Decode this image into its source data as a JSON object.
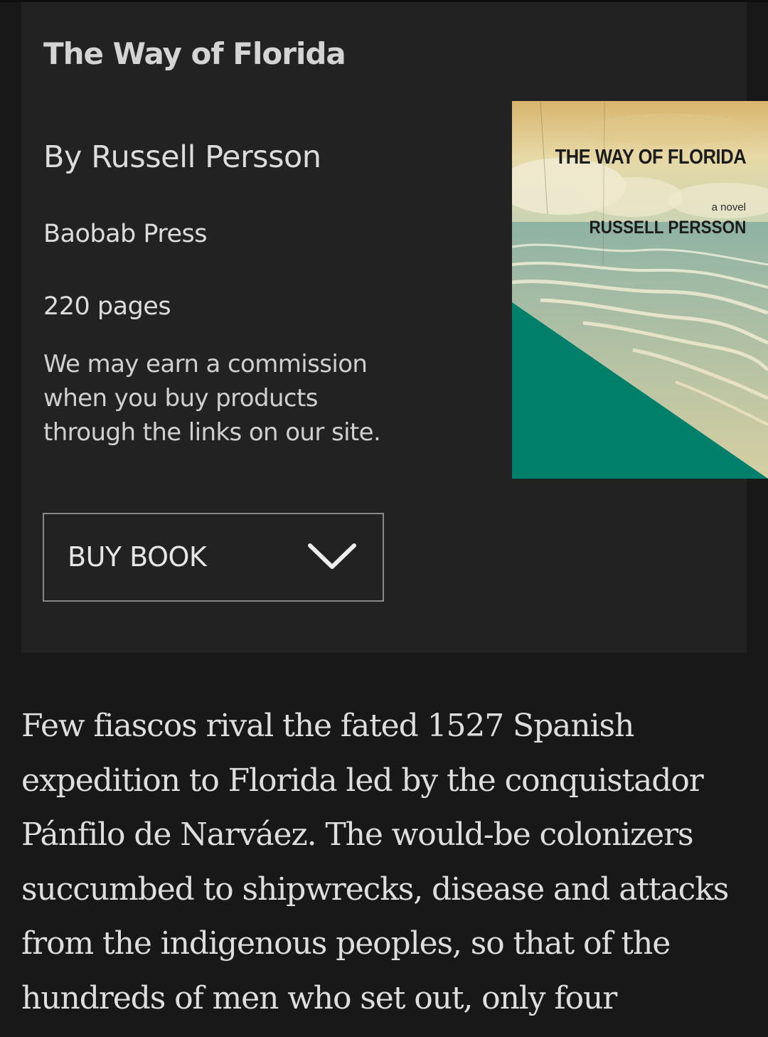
{
  "book": {
    "title": "The Way of Florida",
    "author": "By Russell Persson",
    "publisher": "Baobab Press",
    "pages": "220 pages",
    "disclaimer": "We may earn a commission when you buy products through the links on our site.",
    "buy_label": "BUY BOOK"
  },
  "cover": {
    "title": "THE WAY OF FLORIDA",
    "subtitle": "a novel",
    "author": "RUSSELL PERSSON",
    "accent_color": "#007f6a"
  },
  "article": {
    "body": "Few fiascos rival the fated 1527 Spanish expedition to Florida led by the conquistador Pánfilo de Narváez. The would-be colonizers succumbed to shipwrecks, disease and attacks from the indigenous peoples, so that of the hundreds of men who set out, only four"
  },
  "icons": {
    "buy_toggle": "chevron-down-icon"
  }
}
